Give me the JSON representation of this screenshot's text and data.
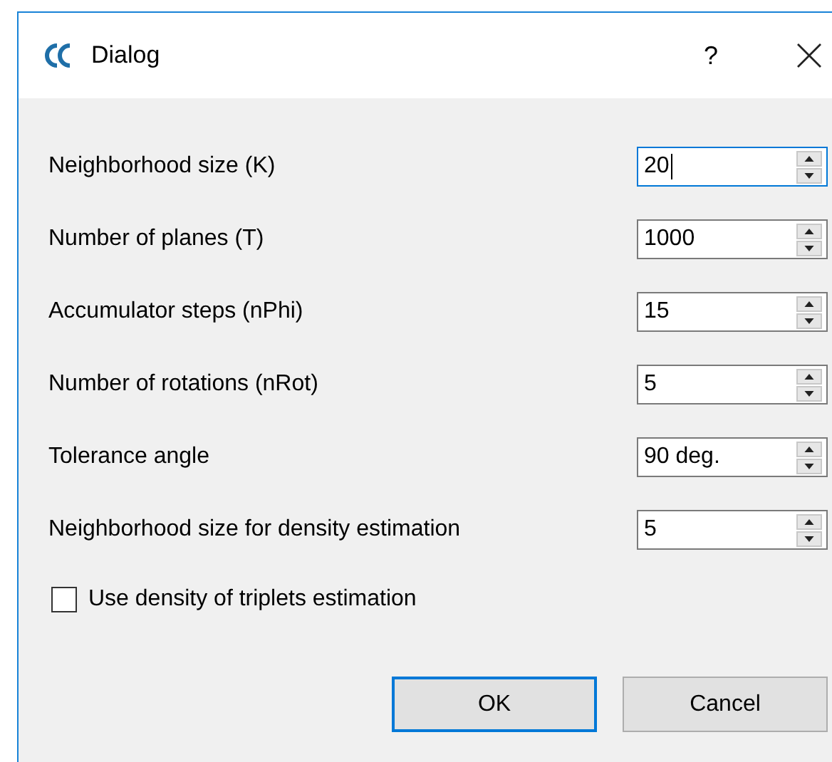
{
  "window": {
    "title": "Dialog",
    "help": "?"
  },
  "fields": [
    {
      "label": "Neighborhood size (K)",
      "value": "20",
      "focused": true
    },
    {
      "label": "Number of planes (T)",
      "value": "1000",
      "focused": false
    },
    {
      "label": "Accumulator steps (nPhi)",
      "value": "15",
      "focused": false
    },
    {
      "label": "Number of rotations (nRot)",
      "value": "5",
      "focused": false
    },
    {
      "label": "Tolerance angle",
      "value": "90 deg.",
      "focused": false
    },
    {
      "label": "Neighborhood size for density estimation",
      "value": "5",
      "focused": false
    }
  ],
  "checkbox": {
    "label": "Use density of triplets estimation",
    "checked": false
  },
  "buttons": [
    {
      "label": "OK",
      "default": true
    },
    {
      "label": "Cancel",
      "default": false
    }
  ]
}
